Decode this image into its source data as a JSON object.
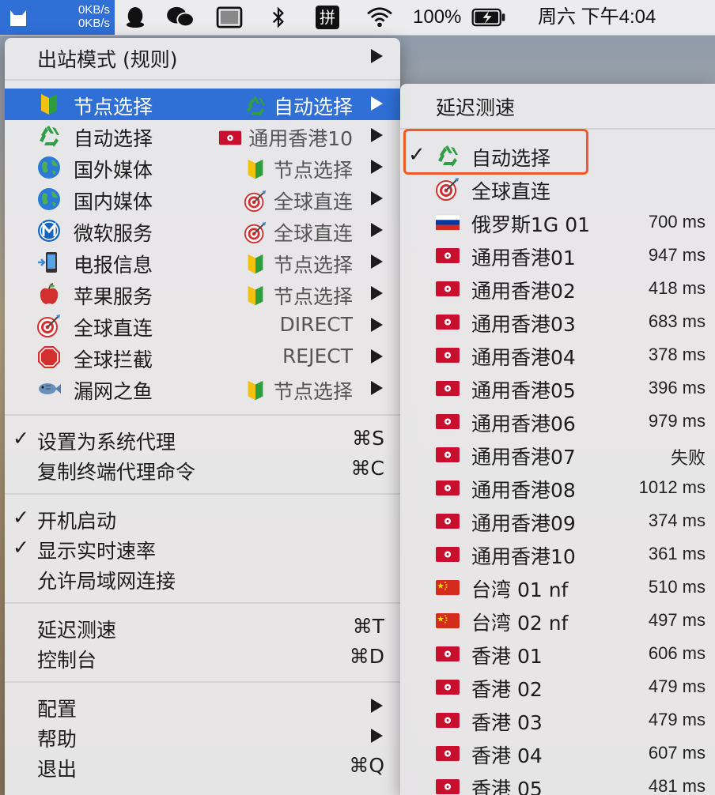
{
  "menubar": {
    "speed_up": "0KB/s",
    "speed_down": "0KB/s",
    "battery": "100%",
    "datetime": "周六 下午4:04",
    "input_method": "拼"
  },
  "main_menu": {
    "outbound_mode": "出站模式 (规则)",
    "groups": [
      {
        "label": "节点选择",
        "icon": "beginner-icon",
        "value": "自动选择",
        "value_icon": "recycle-icon"
      },
      {
        "label": "自动选择",
        "icon": "recycle-icon",
        "value": "通用香港10",
        "value_icon": "hk-flag-icon"
      },
      {
        "label": "国外媒体",
        "icon": "globe-icon",
        "value": "节点选择",
        "value_icon": "beginner-icon"
      },
      {
        "label": "国内媒体",
        "icon": "globe-icon",
        "value": "全球直连",
        "value_icon": "target-icon"
      },
      {
        "label": "微软服务",
        "icon": "metro-icon",
        "value": "全球直连",
        "value_icon": "target-icon"
      },
      {
        "label": "电报信息",
        "icon": "phone-icon",
        "value": "节点选择",
        "value_icon": "beginner-icon"
      },
      {
        "label": "苹果服务",
        "icon": "apple-icon",
        "value": "节点选择",
        "value_icon": "beginner-icon"
      },
      {
        "label": "全球直连",
        "icon": "target-icon",
        "value": "DIRECT",
        "value_icon": ""
      },
      {
        "label": "全球拦截",
        "icon": "stop-icon",
        "value": "REJECT",
        "value_icon": ""
      },
      {
        "label": "漏网之鱼",
        "icon": "fish-icon",
        "value": "节点选择",
        "value_icon": "beginner-icon"
      }
    ],
    "set_system_proxy": "设置为系统代理",
    "set_system_proxy_shortcut": "⌘S",
    "copy_terminal": "复制终端代理命令",
    "copy_terminal_shortcut": "⌘C",
    "start_at_login": "开机启动",
    "show_speed": "显示实时速率",
    "allow_lan": "允许局域网连接",
    "latency_test": "延迟测速",
    "latency_test_shortcut": "⌘T",
    "console": "控制台",
    "console_shortcut": "⌘D",
    "config": "配置",
    "help": "帮助",
    "quit": "退出",
    "quit_shortcut": "⌘Q",
    "check": "✓"
  },
  "submenu": {
    "header": "延迟测速",
    "items": [
      {
        "label": "自动选择",
        "icon": "recycle-icon",
        "ms": "",
        "checked": true
      },
      {
        "label": "全球直连",
        "icon": "target-icon",
        "ms": "",
        "checked": false
      },
      {
        "label": "俄罗斯1G 01",
        "icon": "ru-flag-icon",
        "ms": "700 ms",
        "checked": false
      },
      {
        "label": "通用香港01",
        "icon": "hk-flag-icon",
        "ms": "947 ms"
      },
      {
        "label": "通用香港02",
        "icon": "hk-flag-icon",
        "ms": "418 ms"
      },
      {
        "label": "通用香港03",
        "icon": "hk-flag-icon",
        "ms": "683 ms"
      },
      {
        "label": "通用香港04",
        "icon": "hk-flag-icon",
        "ms": "378 ms"
      },
      {
        "label": "通用香港05",
        "icon": "hk-flag-icon",
        "ms": "396 ms"
      },
      {
        "label": "通用香港06",
        "icon": "hk-flag-icon",
        "ms": "979 ms"
      },
      {
        "label": "通用香港07",
        "icon": "hk-flag-icon",
        "ms": "失败"
      },
      {
        "label": "通用香港08",
        "icon": "hk-flag-icon",
        "ms": "1012 ms"
      },
      {
        "label": "通用香港09",
        "icon": "hk-flag-icon",
        "ms": "374 ms"
      },
      {
        "label": "通用香港10",
        "icon": "hk-flag-icon",
        "ms": "361 ms"
      },
      {
        "label": "台湾 01 nf",
        "icon": "cn-flag-icon",
        "ms": "510 ms"
      },
      {
        "label": "台湾 02 nf",
        "icon": "cn-flag-icon",
        "ms": "497 ms"
      },
      {
        "label": "香港 01",
        "icon": "hk-flag-icon",
        "ms": "606 ms"
      },
      {
        "label": "香港 02",
        "icon": "hk-flag-icon",
        "ms": "479 ms"
      },
      {
        "label": "香港 03",
        "icon": "hk-flag-icon",
        "ms": "479 ms"
      },
      {
        "label": "香港 04",
        "icon": "hk-flag-icon",
        "ms": "607 ms"
      },
      {
        "label": "香港 05",
        "icon": "hk-flag-icon",
        "ms": "481 ms"
      }
    ]
  },
  "colors": {
    "accent": "#2f6fd6",
    "highlight_border": "#f05a28"
  }
}
